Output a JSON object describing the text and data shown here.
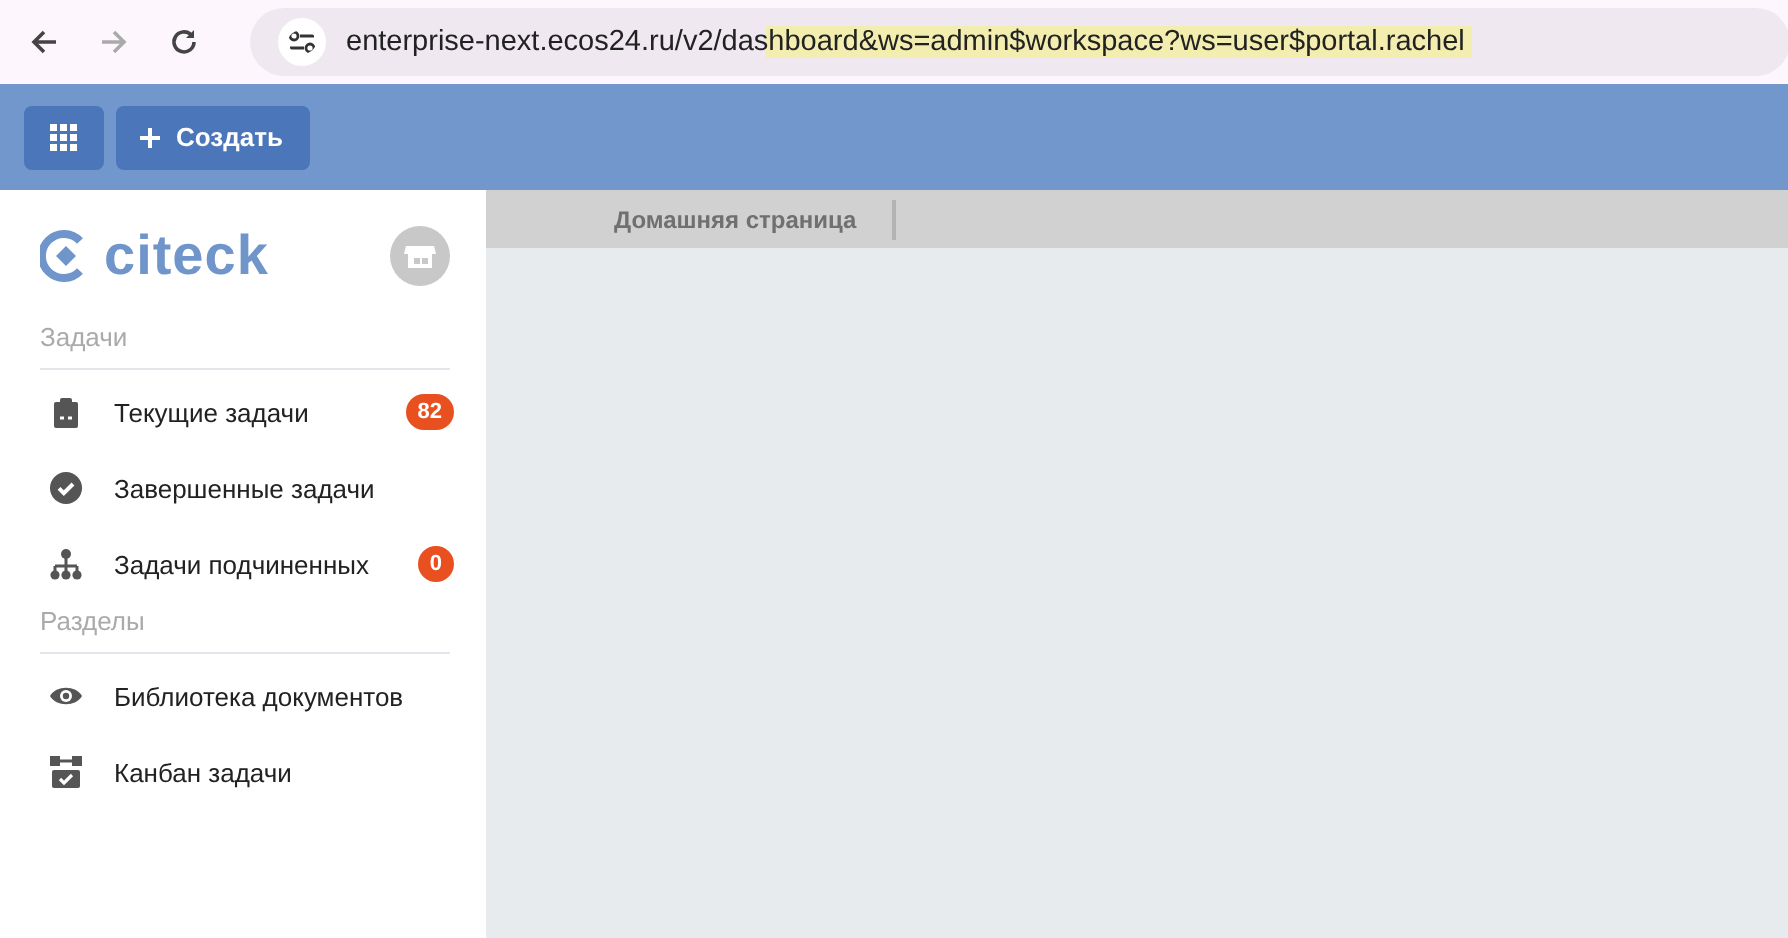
{
  "browser": {
    "url": "enterprise-next.ecos24.ru/v2/dashboard&ws=admin$workspace?ws=user$portal.rachel"
  },
  "header": {
    "create_button": "Создать"
  },
  "sidebar": {
    "logo": "citeck",
    "sections": [
      {
        "title": "Задачи",
        "items": [
          {
            "label": "Текущие задачи",
            "badge": "82"
          },
          {
            "label": "Завершенные задачи"
          },
          {
            "label": "Задачи подчиненных",
            "badge": "0"
          }
        ]
      },
      {
        "title": "Разделы",
        "items": [
          {
            "label": "Библиотека документов"
          },
          {
            "label": "Канбан задачи"
          }
        ]
      }
    ]
  },
  "tabs": [
    {
      "label": "Домашняя страница"
    }
  ]
}
